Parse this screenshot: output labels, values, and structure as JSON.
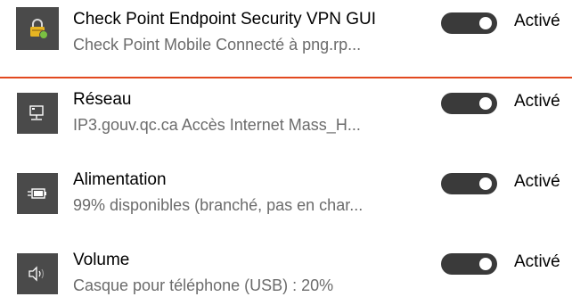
{
  "colors": {
    "divider": "#e2491f",
    "tile_background": "#4a4a4a",
    "toggle_on": "#3a3a3a",
    "lock_body": "#e6b422",
    "status_dot": "#7ac142"
  },
  "items": [
    {
      "title": "Check Point Endpoint Security VPN GUI",
      "subtitle": "Check Point Mobile Connecté à png.rp...",
      "state": "Activé",
      "icon": "vpn-lock-icon",
      "enabled": true
    },
    {
      "title": "Réseau",
      "subtitle": "IP3.gouv.qc.ca Accès Internet  Mass_H...",
      "state": "Activé",
      "icon": "network-icon",
      "enabled": true
    },
    {
      "title": "Alimentation",
      "subtitle": "99% disponibles (branché, pas en char...",
      "state": "Activé",
      "icon": "battery-charging-icon",
      "enabled": true
    },
    {
      "title": "Volume",
      "subtitle": "Casque pour téléphone (USB) : 20%",
      "state": "Activé",
      "icon": "speaker-icon",
      "enabled": true
    }
  ]
}
